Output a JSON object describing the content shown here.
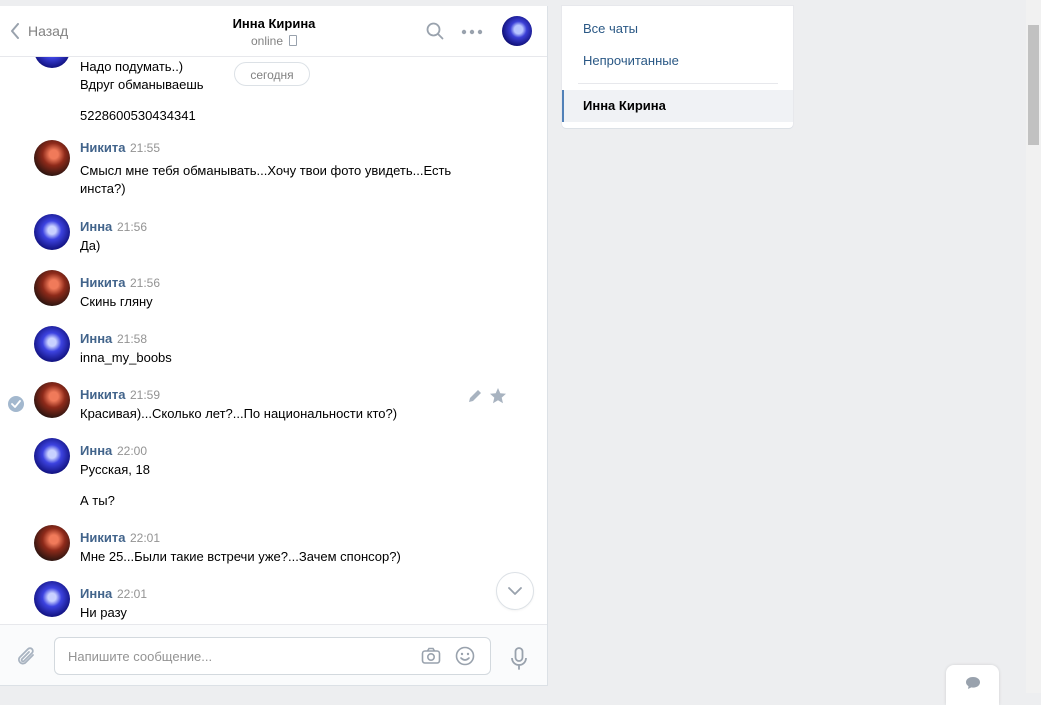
{
  "header": {
    "back_label": "Назад",
    "title": "Инна Кирина",
    "status": "online"
  },
  "date_divider": "сегодня",
  "messages": [
    {
      "author": "",
      "time": "",
      "lines": [
        "Надо подумать..)",
        "Вдруг обманываешь",
        "5228600530434341"
      ]
    },
    {
      "author": "Никита",
      "time": "21:55",
      "text": "Смысл мне тебя обманывать...Хочу твои фото увидеть...Есть инста?)"
    },
    {
      "author": "Инна",
      "time": "21:56",
      "text": "Да)"
    },
    {
      "author": "Никита",
      "time": "21:56",
      "text": "Скинь гляну"
    },
    {
      "author": "Инна",
      "time": "21:58",
      "text": "inna_my_boobs"
    },
    {
      "author": "Никита",
      "time": "21:59",
      "text": "Красивая)...Сколько лет?...По национальности кто?)"
    },
    {
      "author": "Инна",
      "time": "22:00",
      "text": "Русская, 18",
      "text2": "А ты?"
    },
    {
      "author": "Никита",
      "time": "22:01",
      "text": "Мне 25...Были такие встречи уже?...Зачем спонсор?)"
    },
    {
      "author": "Инна",
      "time": "22:01",
      "text": "Ни разу"
    }
  ],
  "composer": {
    "placeholder": "Напишите сообщение..."
  },
  "sidebar": {
    "items": [
      "Все чаты",
      "Непрочитанные"
    ],
    "active": "Инна Кирина"
  }
}
